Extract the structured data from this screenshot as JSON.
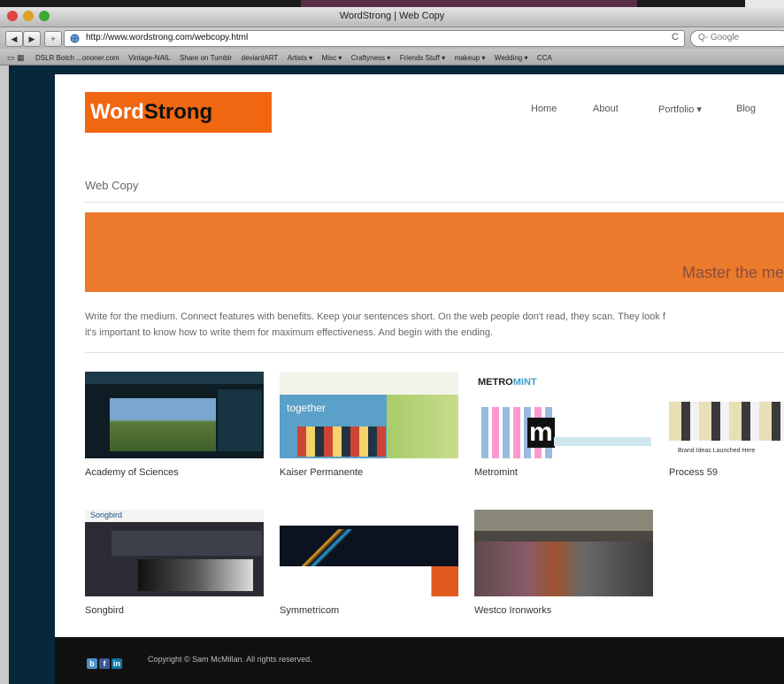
{
  "window": {
    "title": "WordStrong | Web Copy"
  },
  "browser": {
    "url": "http://www.wordstrong.com/webcopy.html",
    "search_placeholder": "Q- Google",
    "reload": "C",
    "back": "◀",
    "forward": "▶",
    "add": "+"
  },
  "bookmarks": [
    "DSLR Botch ...ononer.com",
    "Vintage-NAIL",
    "Share on Tumblr",
    "deviantART",
    "Artists ▾",
    "Misc ▾",
    "Craftyness ▾",
    "Friends Stuff ▾",
    "makeup ▾",
    "Wedding ▾",
    "CCA"
  ],
  "site": {
    "logo_word": "Word",
    "logo_strong": "Strong",
    "nav": [
      "Home",
      "About",
      "Portfolio ▾",
      "Blog"
    ],
    "page_title": "Web Copy",
    "banner_text": "Master the me",
    "intro_line1": "Write for the medium. Connect features with benefits. Keep your sentences short. On the web people don't read, they scan. They look f",
    "intro_line2": "it's important to know how to write them for maximum effectiveness. And begin with the ending.",
    "portfolio": [
      {
        "caption": "Academy of Sciences"
      },
      {
        "caption": "Kaiser Permanente",
        "thumb_text": "together"
      },
      {
        "caption": "Metromint",
        "thumb_text_a": "METRO",
        "thumb_text_b": "MINT",
        "thumb_text_c": "m"
      },
      {
        "caption": "Process 59",
        "thumb_text": "Brand Ideas Launched Here"
      },
      {
        "caption": "Songbird",
        "thumb_text": "Songbird"
      },
      {
        "caption": "Symmetricom"
      },
      {
        "caption": "Westco Ironworks"
      }
    ],
    "footer_copyright": "Copyright © Sam McMillan. All rights reserved.",
    "footer_icons": [
      "b",
      "f",
      "in"
    ]
  },
  "colors": {
    "brand_orange": "#f06611",
    "banner_orange": "#ec7a2c",
    "backdrop": "#06283a",
    "footer": "#111111"
  }
}
